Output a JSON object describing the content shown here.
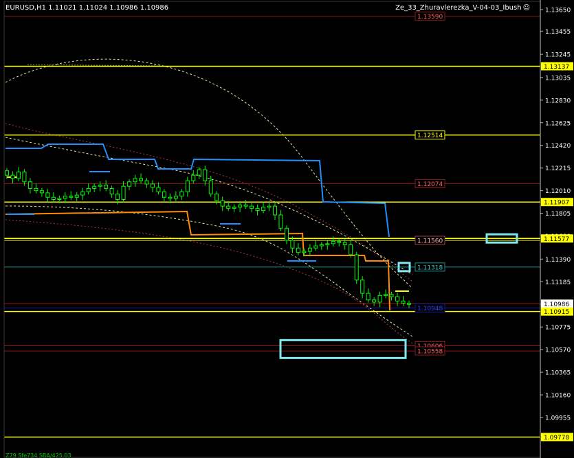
{
  "header": {
    "symbol_info": "EURUSD,H1  1.11021 1.11024 1.10986 1.10986",
    "indicator_name": "Ze_33_Zhuravlerezka_V-04-03_Ibush",
    "smiley_icon": "smiley-icon"
  },
  "footer": {
    "partial_text": "Z79 Sfe734 SBA/425.03"
  },
  "colors": {
    "background": "#000000",
    "axis": "#c0c0c0",
    "candles": "#00ff00",
    "yellow_level": "#ffff00",
    "red_level": "#8b1c1c",
    "orange_line": "#ff8c00",
    "blue_line": "#1e90ff",
    "cyan_marker": "#7fe9ee",
    "teal_level": "#1f8c8c",
    "current_price_line": "#a01010",
    "navy_level": "#1a1a9a",
    "envelope": "#e6e6a0",
    "envelope_red": "#b23a3a"
  },
  "chart_data": {
    "type": "candlestick",
    "symbol": "EURUSD",
    "timeframe": "H1",
    "ylim": [
      1.0955,
      1.1382
    ],
    "price_axis_ticks": [
      "1.13650",
      "1.13455",
      "1.13245",
      "1.13035",
      "1.12830",
      "1.12625",
      "1.12420",
      "1.12215",
      "1.12010",
      "1.11805",
      "1.11600",
      "1.11390",
      "1.11185",
      "1.10980",
      "1.10775",
      "1.10570",
      "1.10365",
      "1.10160",
      "1.09955"
    ],
    "price_levels": [
      {
        "label": "1.13590",
        "value": 1.1359,
        "color": "#8b1c1c",
        "style": "red_boxed"
      },
      {
        "label": "1.13137",
        "value": 1.13137,
        "color": "#ffff00",
        "style": "axis_tag"
      },
      {
        "label": "1.12514",
        "value": 1.12514,
        "color": "#ffff00",
        "style": "boxed"
      },
      {
        "label": "1.12074",
        "value": 1.12074,
        "color": "#8b1c1c",
        "style": "red_boxed"
      },
      {
        "label": "1.11907",
        "value": 1.11907,
        "color": "#ffff00",
        "style": "axis_tag"
      },
      {
        "label": "1.11560",
        "value": 1.1156,
        "color": "#ffff00",
        "style": "red_boxed"
      },
      {
        "label": "1.11577",
        "value": 1.11577,
        "color": "#ffff00",
        "style": "axis_tag"
      },
      {
        "label": "1.11318",
        "value": 1.11318,
        "color": "#1f8c8c",
        "style": "teal_boxed"
      },
      {
        "label": "1.10986",
        "value": 1.10986,
        "color": "#ffffff",
        "style": "axis_tag_white"
      },
      {
        "label": "1.10948",
        "value": 1.10948,
        "color": "#1a1a9a",
        "style": "navy_boxed"
      },
      {
        "label": "1.10915",
        "value": 1.10915,
        "color": "#ffff00",
        "style": "axis_tag"
      },
      {
        "label": "1.10606",
        "value": 1.10606,
        "color": "#8b1c1c",
        "style": "red_boxed"
      },
      {
        "label": "1.10558",
        "value": 1.10558,
        "color": "#8b1c1c",
        "style": "red_boxed"
      },
      {
        "label": "1.09778",
        "value": 1.09778,
        "color": "#ffff00",
        "style": "axis_tag"
      }
    ],
    "closes": [
      1.1215,
      1.1212,
      1.1218,
      1.1209,
      1.1203,
      1.1201,
      1.1199,
      1.1195,
      1.1193,
      1.1194,
      1.1196,
      1.1195,
      1.1197,
      1.12,
      1.1203,
      1.1205,
      1.1206,
      1.1203,
      1.1198,
      1.1193,
      1.1205,
      1.1209,
      1.1212,
      1.121,
      1.1207,
      1.1204,
      1.12,
      1.1195,
      1.1194,
      1.1196,
      1.12,
      1.121,
      1.1215,
      1.122,
      1.121,
      1.1198,
      1.1192,
      1.1187,
      1.1185,
      1.1186,
      1.1188,
      1.1187,
      1.1185,
      1.1183,
      1.1186,
      1.1187,
      1.1179,
      1.1167,
      1.1156,
      1.1149,
      1.1145,
      1.1146,
      1.1149,
      1.1151,
      1.1152,
      1.1153,
      1.1155,
      1.1154,
      1.1152,
      1.1143,
      1.112,
      1.1108,
      1.1102,
      1.11,
      1.1106,
      1.1107,
      1.1105,
      1.1101,
      1.1099,
      1.1098
    ]
  }
}
